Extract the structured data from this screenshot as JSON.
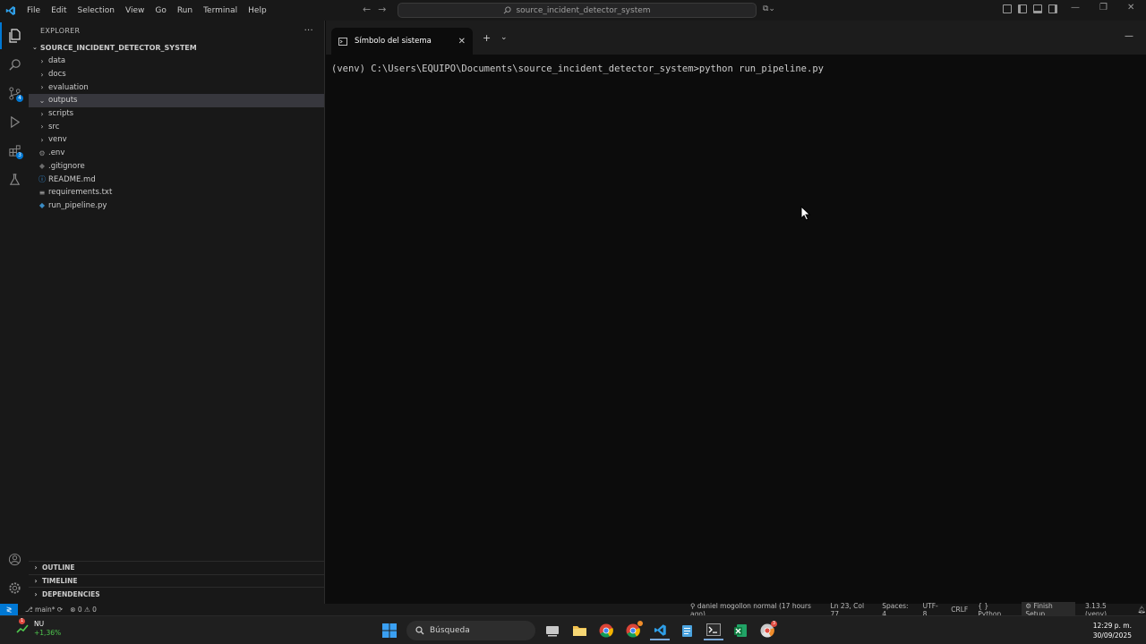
{
  "titlebar": {
    "menu": [
      "File",
      "Edit",
      "Selection",
      "View",
      "Go",
      "Run",
      "Terminal",
      "Help"
    ],
    "command_center": "source_incident_detector_system"
  },
  "activity_badges": {
    "source_control": "4",
    "extensions": "3"
  },
  "explorer": {
    "header": "EXPLORER",
    "root": "SOURCE_INCIDENT_DETECTOR_SYSTEM",
    "items": [
      {
        "label": "data",
        "kind": "folder",
        "expanded": false
      },
      {
        "label": "docs",
        "kind": "folder",
        "expanded": false
      },
      {
        "label": "evaluation",
        "kind": "folder",
        "expanded": false
      },
      {
        "label": "outputs",
        "kind": "folder",
        "expanded": true,
        "selected": true
      },
      {
        "label": "scripts",
        "kind": "folder",
        "expanded": false
      },
      {
        "label": "src",
        "kind": "folder",
        "expanded": false
      },
      {
        "label": "venv",
        "kind": "folder",
        "expanded": false
      },
      {
        "label": ".env",
        "kind": "gear"
      },
      {
        "label": ".gitignore",
        "kind": "git"
      },
      {
        "label": "README.md",
        "kind": "info"
      },
      {
        "label": "requirements.txt",
        "kind": "lines"
      },
      {
        "label": "run_pipeline.py",
        "kind": "python"
      }
    ],
    "sections": [
      "OUTLINE",
      "TIMELINE",
      "DEPENDENCIES"
    ]
  },
  "terminal": {
    "tab_title": "Símbolo del sistema",
    "command_line": "(venv) C:\\Users\\EQUIPO\\Documents\\source_incident_detector_system>python run_pipeline.py"
  },
  "statusbar": {
    "branch": "main*",
    "errors": "0",
    "warnings": "0",
    "blame": "daniel mogollon normal (17 hours ago)",
    "position": "Ln 23, Col 77",
    "spaces": "Spaces: 4",
    "encoding": "UTF-8",
    "eol": "CRLF",
    "language": "Python",
    "finish_setup": "Finish Setup",
    "interpreter": "3.13.5 (venv)"
  },
  "taskbar": {
    "ticker": "NU",
    "change": "+1,36%",
    "ticker_badge": "1",
    "search_placeholder": "Búsqueda",
    "chrome_badge": "3",
    "time": "12:29 p. m.",
    "date": "30/09/2025"
  },
  "colors": {
    "accent": "#0078d4",
    "terminal_bg": "#0c0c0c",
    "sidebar_bg": "#181818",
    "selected_row": "#37373d"
  }
}
